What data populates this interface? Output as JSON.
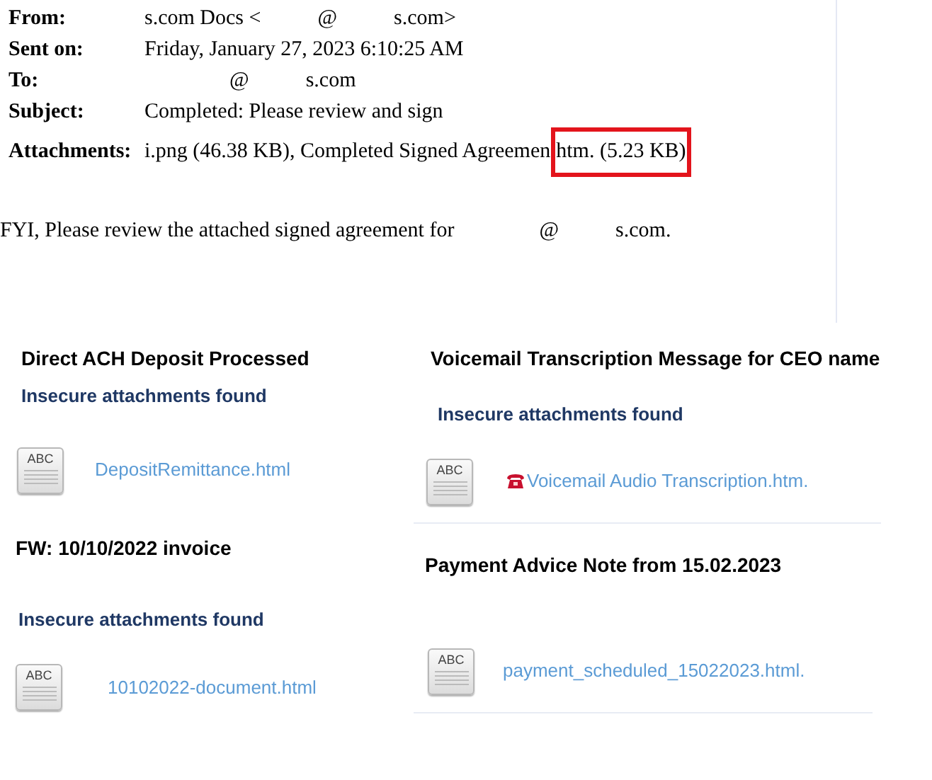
{
  "email": {
    "headers": [
      {
        "label": "From:",
        "parts": [
          {
            "text": "s.com Docs <",
            "highlighted": false
          },
          {
            "text": "@",
            "highlighted": false
          },
          {
            "text": "s.com>",
            "highlighted": false
          }
        ]
      },
      {
        "label": "Sent on:",
        "parts": [
          {
            "text": "Friday, January 27, 2023 6:10:25 AM",
            "highlighted": false
          }
        ]
      },
      {
        "label": "To:",
        "parts": [
          {
            "text": "@",
            "highlighted": false
          },
          {
            "text": "s.com",
            "highlighted": false
          }
        ]
      },
      {
        "label": "Subject:",
        "parts": [
          {
            "text": "Completed: Please review and sign",
            "highlighted": false
          }
        ]
      },
      {
        "label": "Attachments:",
        "parts": [
          {
            "text": "i.png (46.38 KB), Completed Signed Agreemen",
            "highlighted": false
          },
          {
            "text": "htm. (5.23 KB)",
            "highlighted": true
          }
        ]
      }
    ],
    "body": [
      "FYI, Please review the attached signed agreement for",
      "@",
      "s.com."
    ]
  },
  "messages": [
    {
      "subject": "Direct ACH Deposit Processed",
      "notice": "Insecure attachments found",
      "attachment": {
        "icon_label": "ABC",
        "name": "DepositRemittance.html",
        "phone_icon": false
      }
    },
    {
      "subject": "FW: 10/10/2022 invoice",
      "notice": "Insecure attachments found",
      "attachment": {
        "icon_label": "ABC",
        "name": "10102022-document.html",
        "phone_icon": false
      }
    },
    {
      "subject": "Voicemail Transcription Message for CEO name",
      "notice": "Insecure attachments found",
      "attachment": {
        "icon_label": "ABC",
        "name": "Voicemail Audio Transcription.htm.",
        "phone_icon": true
      }
    },
    {
      "subject": "Payment Advice Note from 15.02.2023",
      "attachment": {
        "icon_label": "ABC",
        "name": "payment_scheduled_15022023.html.",
        "phone_icon": false
      }
    }
  ]
}
